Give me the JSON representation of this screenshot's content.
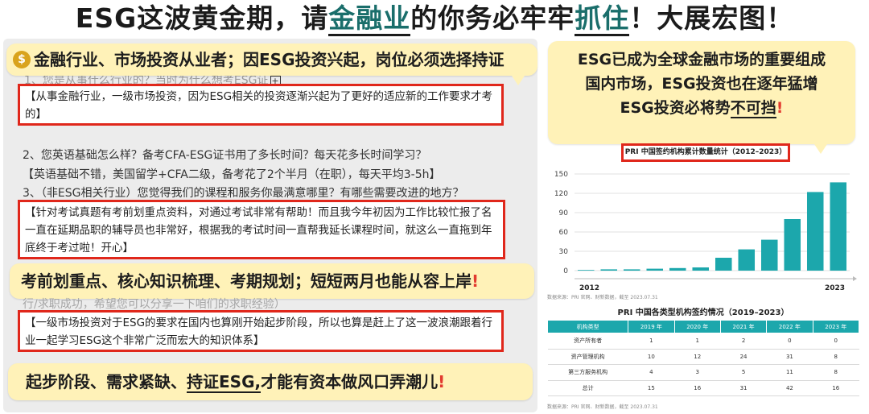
{
  "headline": {
    "part1": "ESG这波黄金期，请",
    "highlight": "金融业",
    "part2": "的你务必牢牢",
    "underlined": "抓住",
    "part3": "！大展宏图！"
  },
  "callout1": {
    "icon": "money-bag-icon",
    "text": "金融行业、市场投资从业者；因ESG投资兴起，岗位必须选择持证"
  },
  "q1": "1、您是从事什么行业的？当时为什么想考ESG证",
  "a1": "【从事金融行业，一级市场投资，因为ESG相关的投资逐渐兴起为了更好的适应新的工作要求才考的】",
  "q2": "2、您英语基础怎么样？备考CFA-ESG证书用了多长时间？每天花多长时间学习？",
  "a2": "【英语基础不错，美国留学+CFA二级，备考花了2个半月（在职），每天平均3-5h】",
  "q3": "3、（非ESG相关行业）您觉得我们的课程和服务你最满意哪里？有哪些需要改进的地方？",
  "a3": "【针对考试真题有考前划重点资料，对通过考试非常有帮助！而且我今年初因为工作比较忙报了名一直在延期品职的辅导员也非常好，根据我的考试时间一直帮我延长课程时间，就这么一直拖到年底终于考过啦！开心】",
  "callout2": {
    "text": "考前划重点、核心知识梳理、考期规划；短短两月也能从容上岸",
    "mark": "!"
  },
  "faded_line": "行/求职成功，希望您可以分享一下咱们的求职经验）",
  "a4": "【一级市场投资对于ESG的要求在国内也算刚开始起步阶段，所以也算是赶上了这一波浪潮跟着行业一起学习ESG这个非常广泛而宏大的知识体系】",
  "callout3": {
    "part1": "起步阶段、需求紧缺、",
    "underlined": "持证ESG,",
    "part2": "才能有资本做风口弄潮儿",
    "mark": "!"
  },
  "callout4": {
    "line1": "ESG已成为全球金融市场的重要组成",
    "line2": "国内市场，ESG投资也在逐年猛增",
    "line3_part1": "ESG投资必将势",
    "line3_underlined": "不可挡",
    "line3_mark": "!"
  },
  "chart_data": {
    "type": "bar",
    "title": "PRI 中国签约机构累计数量统计（2012–2023）",
    "x_start_label": "2012",
    "x_end_label": "2023",
    "yticks": [
      0,
      30,
      60,
      90,
      120,
      150
    ],
    "ylim": [
      0,
      150
    ],
    "values": [
      1,
      2,
      2,
      3,
      4,
      5,
      20,
      33,
      48,
      80,
      122,
      137
    ],
    "color": "#1ca7ac",
    "grid": true
  },
  "chart_source": "数据来源：PRI 官网、财新数据，截至 2023.07.31",
  "table": {
    "title": "PRI 中国各类型机构签约情况（2019–2023）",
    "headers": [
      "机构类型",
      "2019 年",
      "2020 年",
      "2021 年",
      "2022 年",
      "2023 年"
    ],
    "rows": [
      [
        "资产所有者",
        "1",
        "1",
        "2",
        "0",
        "0"
      ],
      [
        "资产管理机构",
        "10",
        "12",
        "24",
        "31",
        "8"
      ],
      [
        "第三方服务机构",
        "4",
        "3",
        "5",
        "11",
        "8"
      ],
      [
        "总计",
        "15",
        "16",
        "31",
        "42",
        "16"
      ]
    ],
    "header_color": "#1ca7ac"
  },
  "table_source": "数据来源：PRI 官网、财新数据，截至 2023.07.31"
}
